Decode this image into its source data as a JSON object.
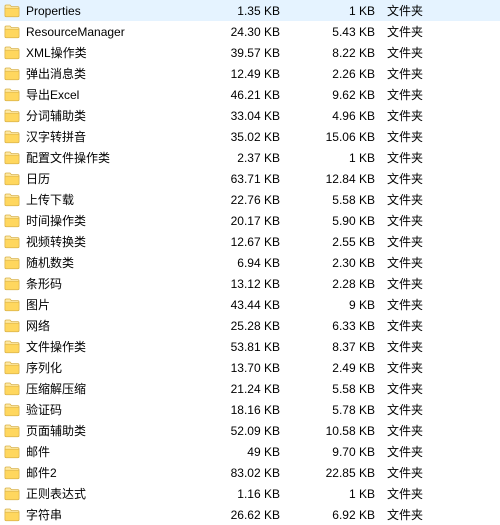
{
  "type_label": "文件夹",
  "rows": [
    {
      "name": "Properties",
      "size1": "1.35 KB",
      "size2": "1 KB"
    },
    {
      "name": "ResourceManager",
      "size1": "24.30 KB",
      "size2": "5.43 KB"
    },
    {
      "name": "XML操作类",
      "size1": "39.57 KB",
      "size2": "8.22 KB"
    },
    {
      "name": "弹出消息类",
      "size1": "12.49 KB",
      "size2": "2.26 KB"
    },
    {
      "name": "导出Excel",
      "size1": "46.21 KB",
      "size2": "9.62 KB"
    },
    {
      "name": "分词辅助类",
      "size1": "33.04 KB",
      "size2": "4.96 KB"
    },
    {
      "name": "汉字转拼音",
      "size1": "35.02 KB",
      "size2": "15.06 KB"
    },
    {
      "name": "配置文件操作类",
      "size1": "2.37 KB",
      "size2": "1 KB"
    },
    {
      "name": "日历",
      "size1": "63.71 KB",
      "size2": "12.84 KB"
    },
    {
      "name": "上传下载",
      "size1": "22.76 KB",
      "size2": "5.58 KB"
    },
    {
      "name": "时间操作类",
      "size1": "20.17 KB",
      "size2": "5.90 KB"
    },
    {
      "name": "视频转换类",
      "size1": "12.67 KB",
      "size2": "2.55 KB"
    },
    {
      "name": "随机数类",
      "size1": "6.94 KB",
      "size2": "2.30 KB"
    },
    {
      "name": "条形码",
      "size1": "13.12 KB",
      "size2": "2.28 KB"
    },
    {
      "name": "图片",
      "size1": "43.44 KB",
      "size2": "9 KB"
    },
    {
      "name": "网络",
      "size1": "25.28 KB",
      "size2": "6.33 KB"
    },
    {
      "name": "文件操作类",
      "size1": "53.81 KB",
      "size2": "8.37 KB"
    },
    {
      "name": "序列化",
      "size1": "13.70 KB",
      "size2": "2.49 KB"
    },
    {
      "name": "压缩解压缩",
      "size1": "21.24 KB",
      "size2": "5.58 KB"
    },
    {
      "name": "验证码",
      "size1": "18.16 KB",
      "size2": "5.78 KB"
    },
    {
      "name": "页面辅助类",
      "size1": "52.09 KB",
      "size2": "10.58 KB"
    },
    {
      "name": "邮件",
      "size1": "49 KB",
      "size2": "9.70 KB"
    },
    {
      "name": "邮件2",
      "size1": "83.02 KB",
      "size2": "22.85 KB"
    },
    {
      "name": "正则表达式",
      "size1": "1.16 KB",
      "size2": "1 KB"
    },
    {
      "name": "字符串",
      "size1": "26.62 KB",
      "size2": "6.92 KB"
    }
  ]
}
